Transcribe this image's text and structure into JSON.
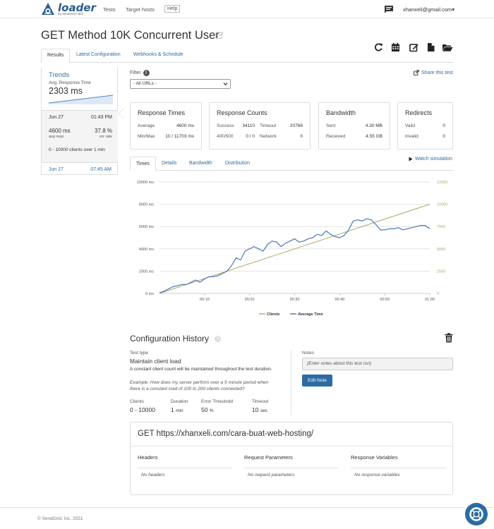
{
  "brand": {
    "name": "loader",
    "tagline": "by SendGrid Labs",
    "color": "#2a5d8f"
  },
  "nav": {
    "links": [
      "Tests",
      "Target hosts"
    ],
    "help_label": "Help",
    "user_email": "xhanxeli@gmail.com",
    "user_caret": "▾"
  },
  "page": {
    "title": "GET Method 10K Concurrent User"
  },
  "tabs": [
    {
      "label": "Results",
      "active": true
    },
    {
      "label": "Latest Configuration",
      "active": false
    },
    {
      "label": "Webhooks & Schedule",
      "active": false
    }
  ],
  "toolbar_icons": [
    "refresh-icon",
    "calendar-icon",
    "edit-icon",
    "file-icon",
    "folder-open-icon"
  ],
  "trends": {
    "title": "Trends",
    "subtitle": "Avg. Response Time",
    "value": "2303 ms",
    "runs": [
      {
        "date": "Jun 27",
        "time": "01:43 PM",
        "avg_resp": "4600 ms",
        "avg_resp_label": "avg resp",
        "err_rate": "37.8 %",
        "err_rate_label": "err rate",
        "clients": "0 - 10000 clients over 1 min"
      },
      {
        "date": "Jun 27",
        "time": "07:45 AM"
      }
    ]
  },
  "filter": {
    "label": "Filter",
    "help": "!",
    "selected": "- All URLs -",
    "share_label": "Share this test"
  },
  "cards": {
    "response_times": {
      "title": "Response Times",
      "rows": [
        {
          "label": "Average",
          "value": "4600 ms"
        },
        {
          "label": "Min/Max",
          "value": "10 / 11703 ms"
        }
      ]
    },
    "response_counts": {
      "title": "Response Counts",
      "rows": [
        {
          "label1": "Success",
          "value1": "34110",
          "label2": "Timeout",
          "value2": "20768"
        },
        {
          "label1": "400/500",
          "value1": "0 / 0",
          "label2": "Network",
          "value2": "0"
        }
      ]
    },
    "bandwidth": {
      "title": "Bandwidth",
      "rows": [
        {
          "label": "Sent",
          "value": "4.30 MB"
        },
        {
          "label": "Received",
          "value": "4.55 GB"
        }
      ]
    },
    "redirects": {
      "title": "Redirects",
      "rows": [
        {
          "label": "Valid",
          "value": "0"
        },
        {
          "label": "Invalid",
          "value": "0"
        }
      ]
    }
  },
  "chart_tabs": [
    {
      "label": "Times",
      "active": true
    },
    {
      "label": "Details",
      "active": false
    },
    {
      "label": "Bandwidth",
      "active": false
    },
    {
      "label": "Distribution",
      "active": false
    }
  ],
  "watch_label": "Watch simulation",
  "chart_data": {
    "type": "line",
    "x_tick_labels": [
      "00:10",
      "00:20",
      "00:30",
      "00:40",
      "00:50",
      "01:00"
    ],
    "x_ticks": [
      10,
      20,
      30,
      40,
      50,
      60
    ],
    "xlim": [
      0,
      60
    ],
    "y_left_ticks": [
      "10000 ms",
      "8000 ms",
      "6000 ms",
      "4000 ms",
      "2000 ms",
      "0 ms"
    ],
    "y_left_values": [
      10000,
      8000,
      6000,
      4000,
      2000,
      0
    ],
    "y_left_lim": [
      0,
      10000
    ],
    "y_right_ticks": [
      "12500",
      "10000",
      "7500",
      "5000",
      "2500",
      "0"
    ],
    "y_right_values": [
      12500,
      10000,
      7500,
      5000,
      2500,
      0
    ],
    "y_right_lim": [
      0,
      12500
    ],
    "grid": true,
    "legend_position": "bottom",
    "series": [
      {
        "name": "Clients",
        "axis": "right",
        "color": "#a5ad62",
        "x": [
          0,
          60
        ],
        "values": [
          0,
          10000
        ]
      },
      {
        "name": "Average Time",
        "axis": "left",
        "color": "#4a77b4",
        "x": [
          0,
          1,
          2,
          3,
          4,
          5,
          6,
          7,
          8,
          9,
          10,
          11,
          12,
          13,
          14,
          15,
          16,
          17,
          18,
          19,
          20,
          21,
          22,
          23,
          24,
          25,
          26,
          27,
          28,
          29,
          30,
          31,
          32,
          33,
          34,
          35,
          36,
          37,
          38,
          39,
          40,
          41,
          42,
          43,
          44,
          45,
          46,
          47,
          48,
          49,
          50,
          51,
          52,
          53,
          54,
          55,
          56,
          57,
          58,
          59,
          60
        ],
        "values": [
          50,
          200,
          400,
          600,
          700,
          800,
          800,
          1000,
          1200,
          1000,
          1300,
          1500,
          1500,
          1600,
          1800,
          2000,
          2500,
          3200,
          3000,
          3800,
          4000,
          4200,
          4000,
          3800,
          4400,
          4700,
          4600,
          4200,
          4500,
          4700,
          4900,
          4600,
          4700,
          4900,
          5000,
          5300,
          5200,
          5600,
          5300,
          5100,
          5000,
          5200,
          5700,
          6500,
          6600,
          6500,
          6700,
          6600,
          6200,
          5700,
          5700,
          5800,
          5800,
          5900,
          5700,
          5800,
          5900,
          6000,
          6100,
          6100,
          5800
        ]
      }
    ]
  },
  "config": {
    "title": "Configuration History",
    "help": "?",
    "test_type_label": "Test type",
    "test_type": "Maintain client load",
    "description": "A constant client count will be maintained throughout the test duration.",
    "example": "Example: How does my server perform over a 5 minute period when there is a constant load of 100 to 200 clients connected?",
    "notes_label": "Notes",
    "notes_placeholder": "(Enter notes about this test run)",
    "edit_note_label": "Edit Note",
    "stats": [
      {
        "label": "Clients",
        "value": "0 - 10000",
        "unit": ""
      },
      {
        "label": "Duration",
        "value": "1",
        "unit": "min"
      },
      {
        "label": "Error Threshold",
        "value": "50",
        "unit": "%"
      },
      {
        "label": "Timeout",
        "value": "10",
        "unit": "sec"
      }
    ]
  },
  "request": {
    "url": "GET https://xhanxeli.com/cara-buat-web-hosting/",
    "columns": [
      {
        "title": "Headers",
        "empty": "No headers"
      },
      {
        "title": "Request Parameters",
        "empty": "No request parameters"
      },
      {
        "title": "Response Variables",
        "empty": "No response variables"
      }
    ]
  },
  "footer": {
    "copyright": "© SendGrid, Inc. 2021"
  }
}
